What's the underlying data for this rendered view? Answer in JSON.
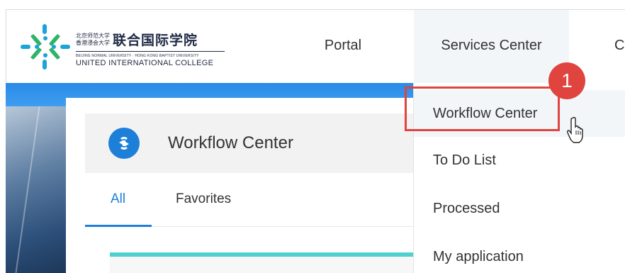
{
  "logo": {
    "cn_small_line1": "北京师范大学",
    "cn_small_line2": "香港浸会大学",
    "cn_big": "联合国际学院",
    "en_small": "BEIJING NORMAL UNIVERSITY · HONG KONG BAPTIST UNIVERSITY",
    "en_big": "UNITED INTERNATIONAL COLLEGE"
  },
  "nav": {
    "portal": "Portal",
    "services_center": "Services Center",
    "next_partial": "C"
  },
  "panel": {
    "title": "Workflow Center",
    "icon": "workflow-icon",
    "tabs": [
      {
        "label": "All",
        "active": true
      },
      {
        "label": "Favorites",
        "active": false
      }
    ]
  },
  "dropdown": {
    "items": [
      {
        "label": "Workflow Center"
      },
      {
        "label": "To Do List"
      },
      {
        "label": "Processed"
      },
      {
        "label": "My application"
      }
    ]
  },
  "annotation": {
    "step_number": "1"
  },
  "colors": {
    "accent": "#1e7fd8",
    "highlight": "#e0443e",
    "teal": "#4fd0d0"
  }
}
